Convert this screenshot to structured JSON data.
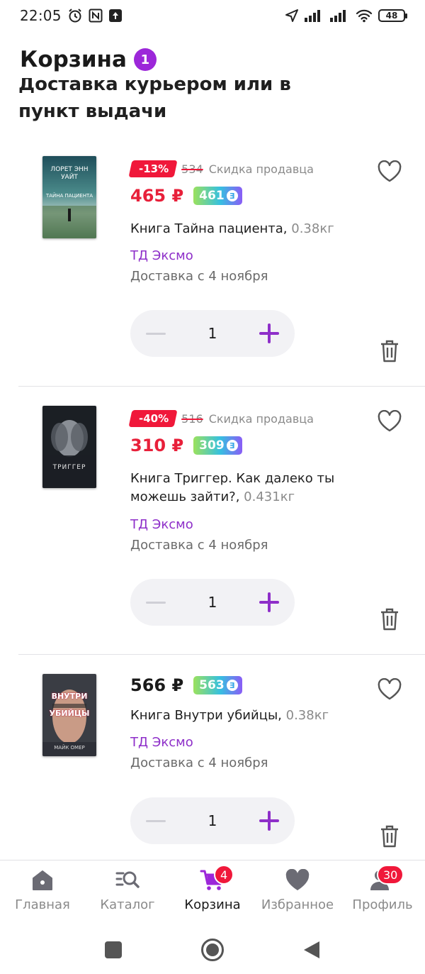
{
  "status_bar": {
    "time": "22:05",
    "battery": "48"
  },
  "header": {
    "title": "Корзина",
    "count": "1"
  },
  "delivery": {
    "title": "Доставка курьером или в пункт выдачи"
  },
  "items": [
    {
      "discount": "-13%",
      "old_price": "534",
      "seller_discount_label": "Скидка продавца",
      "price": "465 ₽",
      "bonus": "461",
      "name": "Книга Тайна пациента,",
      "weight": " 0.38кг",
      "seller": "ТД Эксмо",
      "delivery": "Доставка с 4 ноября",
      "qty": "1",
      "cover_text": "ЛОРЕТ ЭНН УАЙТ",
      "cover_subtitle": "ТАЙНА ПАЦИЕНТА"
    },
    {
      "discount": "-40%",
      "old_price": "516",
      "seller_discount_label": "Скидка продавца",
      "price": "310 ₽",
      "bonus": "309",
      "name": "Книга Триггер. Как далеко ты можешь зайти?,",
      "weight": " 0.431кг",
      "seller": "ТД Эксмо",
      "delivery": "Доставка с 4 ноября",
      "qty": "1",
      "cover_text": "ТРИГГЕР"
    },
    {
      "price": "566 ₽",
      "bonus": "563",
      "name": "Книга Внутри убийцы,",
      "weight": " 0.38кг",
      "seller": "ТД Эксмо",
      "delivery": "Доставка с 4 ноября",
      "qty": "1",
      "cover_text": "ВНУТРИ УБИЙЦЫ",
      "cover_author": "МАЙК ОМЕР"
    }
  ],
  "bottom_nav": [
    {
      "label": "Главная",
      "icon": "home-icon"
    },
    {
      "label": "Каталог",
      "icon": "catalog-search-icon"
    },
    {
      "label": "Корзина",
      "icon": "cart-icon",
      "badge": "4"
    },
    {
      "label": "Избранное",
      "icon": "heart-icon"
    },
    {
      "label": "Профиль",
      "icon": "profile-icon",
      "badge": "30"
    }
  ],
  "colors": {
    "accent": "#8e2fc9",
    "price_red": "#e8203a",
    "discount_red": "#f0183a"
  }
}
